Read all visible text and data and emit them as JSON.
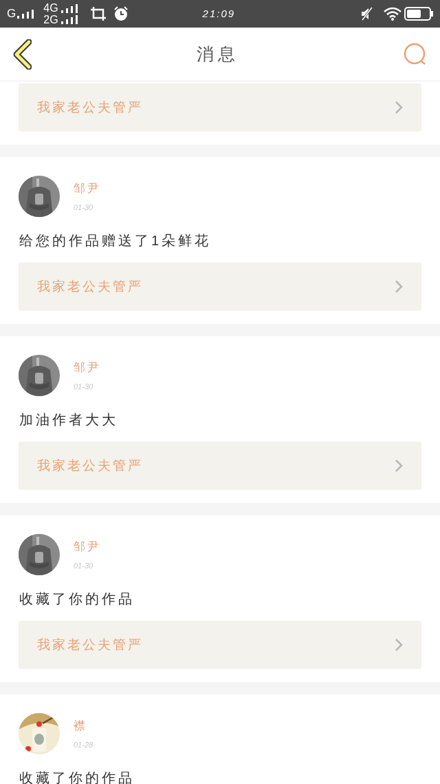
{
  "status_bar": {
    "network_1": "G",
    "network_2_top": "4G",
    "network_2_bottom": "2G",
    "time": "21:09"
  },
  "header": {
    "title": "消息"
  },
  "top_work": {
    "title": "我家老公夫管严"
  },
  "messages": [
    {
      "name": "邹尹",
      "date": "01-30",
      "text": "给您的作品赠送了1朵鲜花",
      "work": {
        "title": "我家老公夫管严"
      }
    },
    {
      "name": "邹尹",
      "date": "01-30",
      "text": "加油作者大大",
      "work": {
        "title": "我家老公夫管严"
      }
    },
    {
      "name": "邹尹",
      "date": "01-30",
      "text": "收藏了你的作品",
      "work": {
        "title": "我家老公夫管严"
      }
    },
    {
      "name": "襟",
      "date": "01-28",
      "text": "收藏了你的作品"
    }
  ]
}
